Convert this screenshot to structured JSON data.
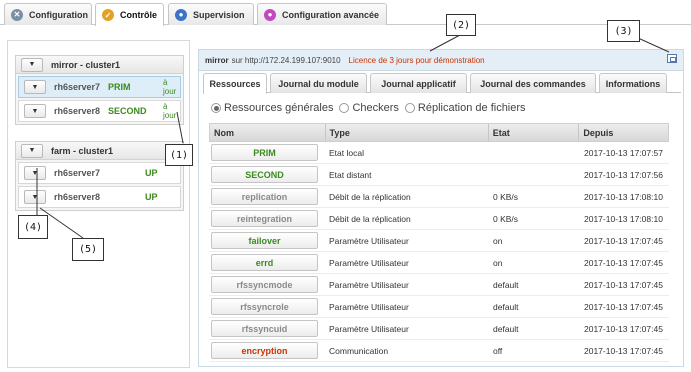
{
  "top_tabs": [
    {
      "label": "Configuration",
      "icon": "x-circle-icon",
      "color": "#7a8fa6"
    },
    {
      "label": "Contrôle",
      "icon": "check-circle-icon",
      "color": "#e5a124"
    },
    {
      "label": "Supervision",
      "icon": "eye-circle-icon",
      "color": "#3b74c4"
    },
    {
      "label": "Configuration avancée",
      "icon": "gear-circle-icon",
      "color": "#c04ac0"
    }
  ],
  "clusters": [
    {
      "title": "mirror - cluster1",
      "servers": [
        {
          "name": "rh6server7",
          "role": "PRIM",
          "state": "à jour"
        },
        {
          "name": "rh6server8",
          "role": "SECOND",
          "state": "à jour"
        }
      ]
    },
    {
      "title": "farm - cluster1",
      "servers": [
        {
          "name": "rh6server7",
          "role": "UP",
          "state": ""
        },
        {
          "name": "rh6server8",
          "role": "UP",
          "state": ""
        }
      ]
    }
  ],
  "main": {
    "server": "mirror",
    "url": "sur http://172.24.199.107:9010",
    "license": "Licence de 3 jours pour démonstration",
    "tabs": [
      "Ressources",
      "Journal du module",
      "Journal applicatif",
      "Journal des commandes",
      "Informations"
    ],
    "radios": [
      "Ressources générales",
      "Checkers",
      "Réplication de fichiers"
    ],
    "columns": [
      "Nom",
      "Type",
      "Etat",
      "Depuis"
    ],
    "rows": [
      {
        "name": "PRIM",
        "type": "Etat local",
        "state": "",
        "since": "2017-10-13 17:07:57",
        "color": "#3b8a1e"
      },
      {
        "name": "SECOND",
        "type": "Etat distant",
        "state": "",
        "since": "2017-10-13 17:07:56",
        "color": "#3b8a1e"
      },
      {
        "name": "replication",
        "type": "Débit de la réplication",
        "state": "0 KB/s",
        "since": "2017-10-13 17:08:10",
        "color": "#8a8a8a"
      },
      {
        "name": "reintegration",
        "type": "Débit de la réplication",
        "state": "0 KB/s",
        "since": "2017-10-13 17:08:10",
        "color": "#8a8a8a"
      },
      {
        "name": "failover",
        "type": "Paramètre Utilisateur",
        "state": "on",
        "since": "2017-10-13 17:07:45",
        "color": "#3b8a1e"
      },
      {
        "name": "errd",
        "type": "Paramètre Utilisateur",
        "state": "on",
        "since": "2017-10-13 17:07:45",
        "color": "#3b8a1e"
      },
      {
        "name": "rfssyncmode",
        "type": "Paramètre Utilisateur",
        "state": "default",
        "since": "2017-10-13 17:07:45",
        "color": "#8a8a8a"
      },
      {
        "name": "rfssyncrole",
        "type": "Paramètre Utilisateur",
        "state": "default",
        "since": "2017-10-13 17:07:45",
        "color": "#8a8a8a"
      },
      {
        "name": "rfssyncuid",
        "type": "Paramètre Utilisateur",
        "state": "default",
        "since": "2017-10-13 17:07:45",
        "color": "#8a8a8a"
      },
      {
        "name": "encryption",
        "type": "Communication",
        "state": "off",
        "since": "2017-10-13 17:07:45",
        "color": "#cc3300"
      }
    ]
  },
  "annotations": [
    "(1)",
    "(2)",
    "(3)",
    "(4)",
    "(5)"
  ]
}
